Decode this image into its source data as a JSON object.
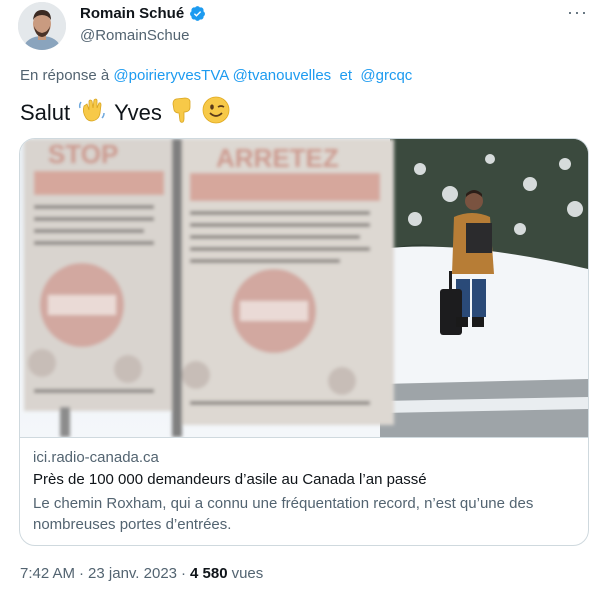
{
  "author": {
    "name": "Romain Schué",
    "handle": "@RomainSchue",
    "verified_color": "#1d9bf0"
  },
  "more_label": "···",
  "reply": {
    "prefix": "En réponse à",
    "mention1": "@poirieryvesTVA",
    "mention2": "@tvanouvelles",
    "connector": "et",
    "mention3": "@grcqc"
  },
  "tweet": {
    "word1": "Salut",
    "emoji1": "👋",
    "word2": "Yves",
    "emoji2": "👇",
    "emoji3": "😉"
  },
  "card": {
    "domain": "ici.radio-canada.ca",
    "title": "Près de 100 000 demandeurs d’asile au Canada l’an passé",
    "description": "Le chemin Roxham, qui a connu une fréquentation record, n’est qu’une des nombreuses portes d’entrées.",
    "sign_left": "STOP",
    "sign_right": "ARRETEZ"
  },
  "footer": {
    "time": "7:42 AM",
    "separator": "·",
    "date": "23 janv. 2023",
    "separator2": "·",
    "views_count": "4 580",
    "views_label": "vues"
  }
}
